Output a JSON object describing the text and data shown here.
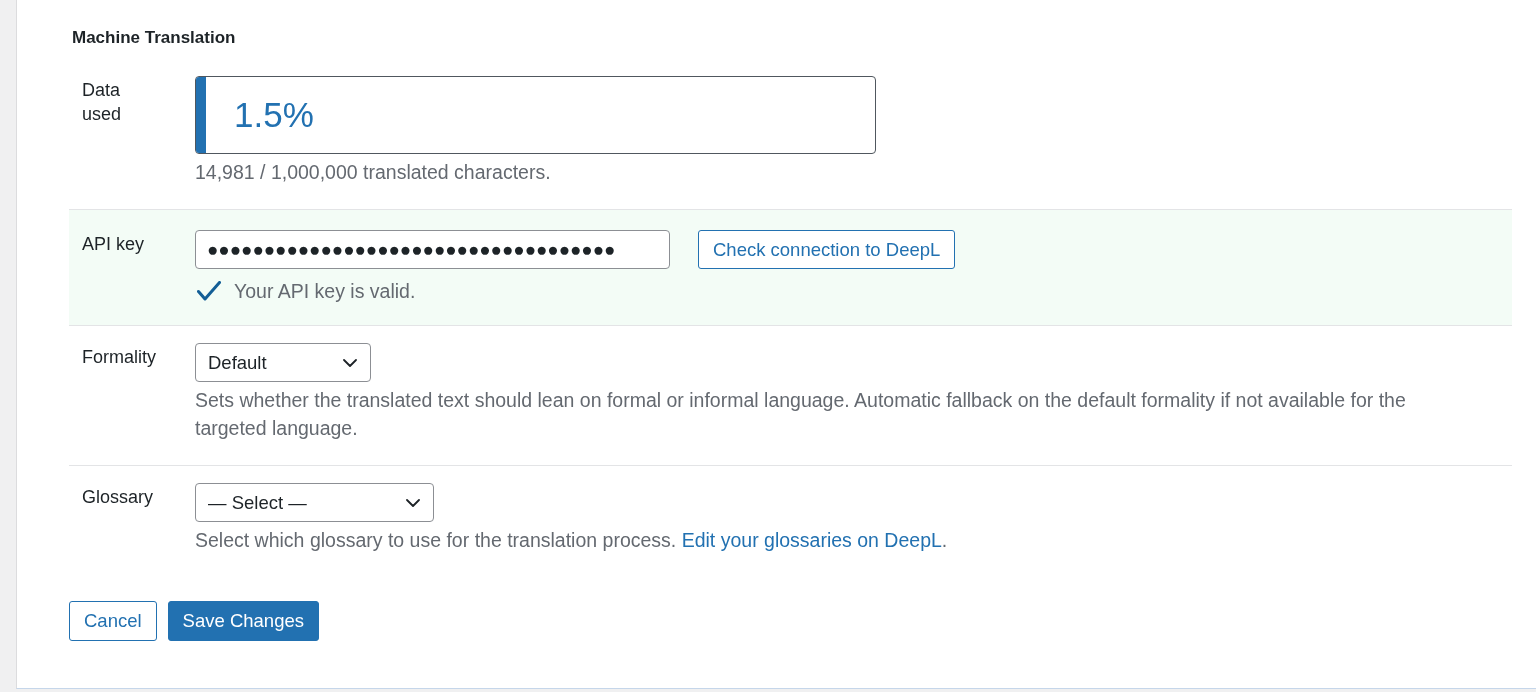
{
  "section": {
    "title": "Machine Translation"
  },
  "fields": [
    {
      "kind": "usage",
      "label": "Data used",
      "level": 0.015,
      "reading": "1.5%",
      "description": "14,981 / 1,000,000 translated characters."
    },
    {
      "kind": "api_key",
      "label": "API key",
      "value": "●●●●●●●●●●●●●●●●●●●●●●●●●●●●●●●●●●●●",
      "button": "Check connection to DeepL",
      "valid": true,
      "message": "Your API key is valid."
    },
    {
      "kind": "select",
      "label": "Formality",
      "value": "Default",
      "description": "Sets whether the translated text should lean on formal or informal language. Automatic fallback on the default formality if not available for the targeted language."
    },
    {
      "kind": "select",
      "label": "Glossary",
      "value": "— Select —",
      "description": "Select which glossary to use for the translation process.",
      "link": "Edit your glossaries on DeepL",
      "link_suffix": "."
    }
  ],
  "buttons": [
    {
      "kind": "cancel",
      "label": "Cancel"
    },
    {
      "kind": "submit",
      "label": "Save Changes"
    }
  ]
}
